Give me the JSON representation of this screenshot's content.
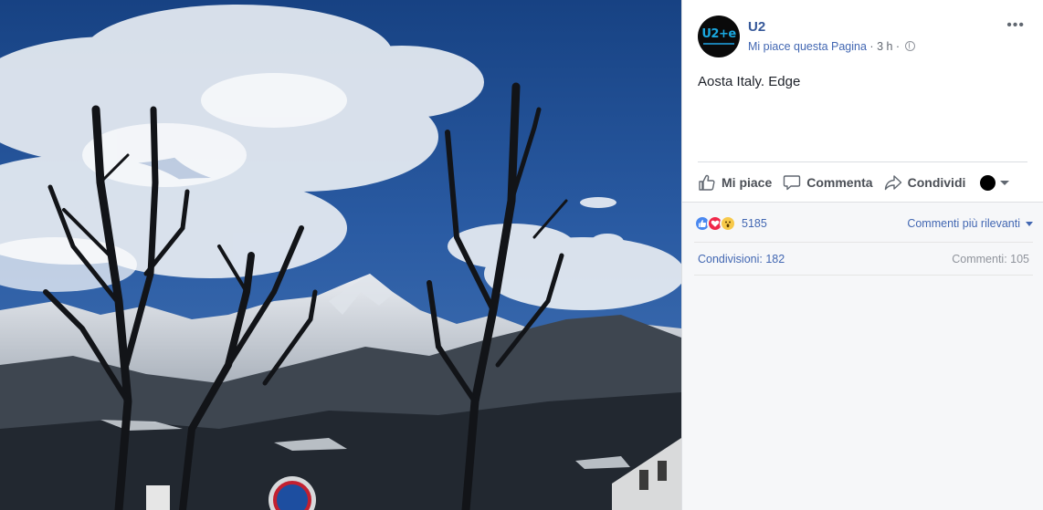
{
  "post": {
    "page_name": "U2",
    "avatar_text": "U2+e",
    "like_page": "Mi piace questa Pagina",
    "separator": " · ",
    "time": "3 h",
    "text": "Aosta Italy. Edge",
    "more_label": "•••"
  },
  "actions": {
    "like": "Mi piace",
    "comment": "Commenta",
    "share": "Condividi"
  },
  "feedback": {
    "reaction_count": "5185",
    "sort_label": "Commenti più rilevanti",
    "shares": "Condivisioni: 182",
    "comments": "Commenti: 105"
  },
  "icons": {
    "avatar": "u2-logo",
    "privacy": "globe-icon",
    "like": "thumb-up-icon",
    "comment": "speech-bubble-icon",
    "share": "share-arrow-icon",
    "reactions": [
      "like",
      "love",
      "wow"
    ]
  },
  "colors": {
    "link": "#365899",
    "accent": "#4267b2",
    "sky": "#1b3f7a"
  }
}
